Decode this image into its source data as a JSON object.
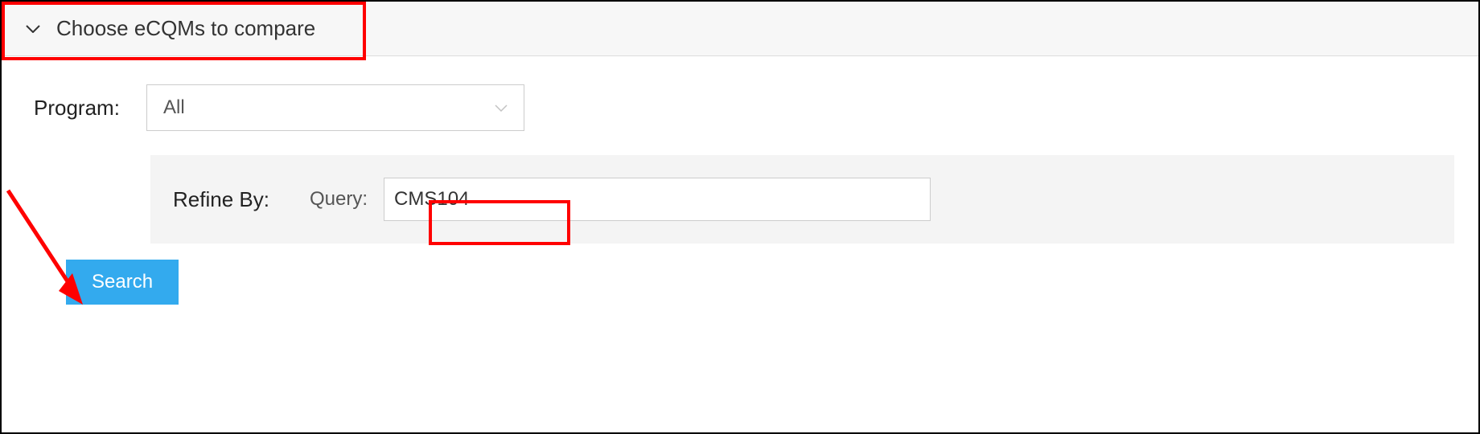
{
  "header": {
    "title": "Choose eCQMs to compare"
  },
  "program": {
    "label": "Program:",
    "selected": "All"
  },
  "refine": {
    "label": "Refine By:",
    "query_label": "Query:",
    "query_value": "CMS104"
  },
  "buttons": {
    "search": "Search"
  }
}
